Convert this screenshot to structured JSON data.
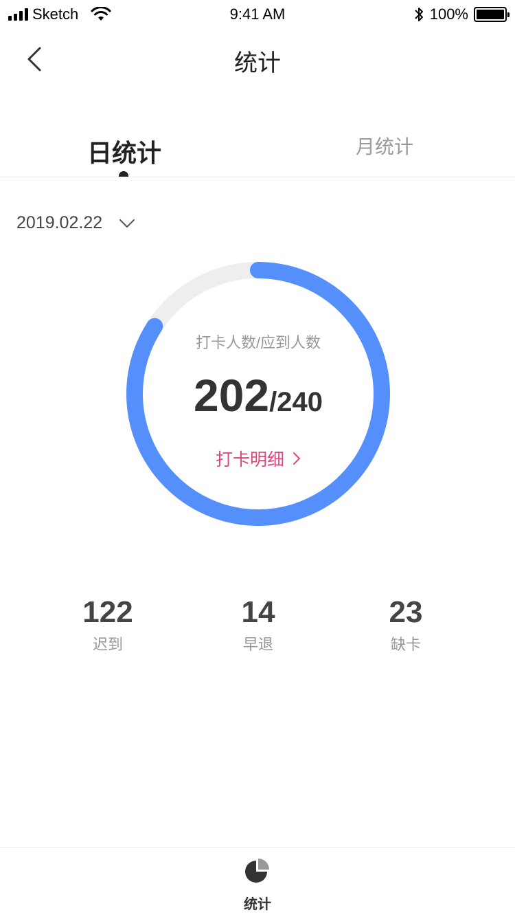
{
  "status_bar": {
    "carrier": "Sketch",
    "time": "9:41 AM",
    "battery": "100%"
  },
  "nav": {
    "title": "统计",
    "back_icon": "chevron-left-icon"
  },
  "tabs": [
    {
      "label": "日统计",
      "active": true
    },
    {
      "label": "月统计",
      "active": false
    }
  ],
  "date": {
    "value": "2019.02.22",
    "icon": "chevron-down-icon"
  },
  "summary": {
    "label": "打卡人数/应到人数",
    "checked_in": "202",
    "expected": "/240",
    "progress": 0.8417,
    "detail_link": "打卡明细",
    "accent_color": "#558ffb",
    "track_color": "#eeeeee",
    "link_color": "#e0487b"
  },
  "stats": [
    {
      "value": "122",
      "label": "迟到"
    },
    {
      "value": "14",
      "label": "早退"
    },
    {
      "value": "23",
      "label": "缺卡"
    }
  ],
  "tabbar": {
    "items": [
      {
        "label": "统计",
        "icon": "pie-chart-icon",
        "active": true
      }
    ]
  }
}
